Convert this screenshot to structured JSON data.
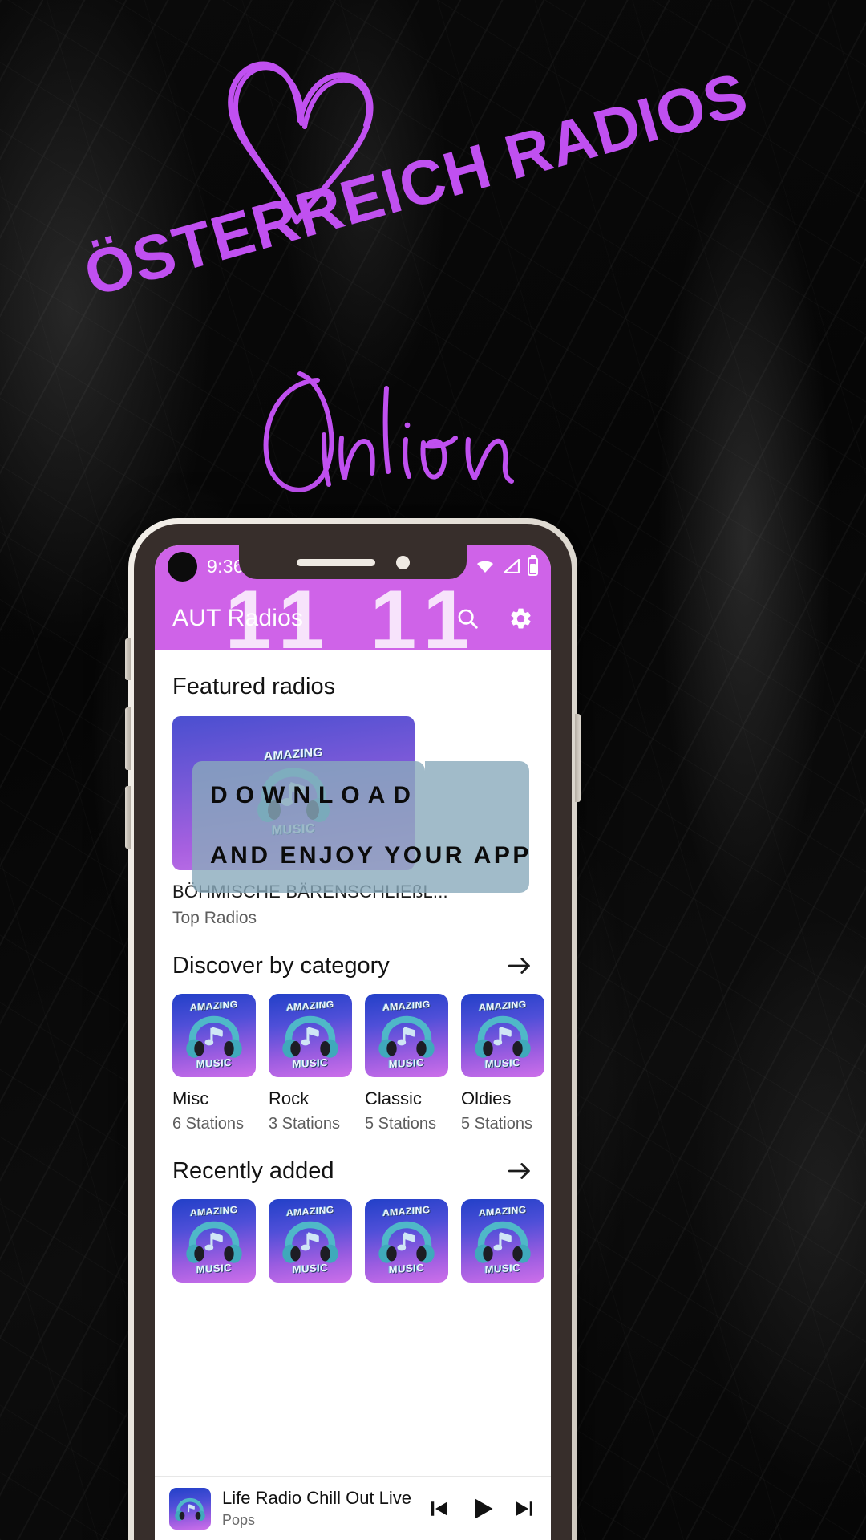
{
  "poster": {
    "heart_icon": "heart-doodle-icon",
    "title": "ÖSTERREICH RADIOS",
    "subtitle_script": "Online",
    "accent_color": "#c050f0",
    "overlay": {
      "line1": "DOWNLOAD",
      "line2": "AND ENJOY YOUR APP",
      "bg_color": "#89aabc"
    }
  },
  "phone": {
    "statusbar": {
      "time": "9:36",
      "icons": [
        "wifi-icon",
        "signal-icon",
        "battery-icon"
      ]
    },
    "watermark": "11 11",
    "appbar": {
      "title": "AUT Radios",
      "actions": [
        {
          "name": "search-icon",
          "label": "Search"
        },
        {
          "name": "gear-icon",
          "label": "Settings"
        }
      ],
      "bg_color": "#cf63e8"
    },
    "sections": {
      "featured": {
        "title": "Featured radios",
        "card": {
          "name": "BÖHMISCHE BÄRENSCHLIEßL...",
          "subtitle": "Top Radios",
          "logo_top": "AMAZING",
          "logo_bottom": "MUSIC"
        }
      },
      "categories": {
        "title": "Discover by category",
        "more_icon": "arrow-right-icon",
        "items": [
          {
            "name": "Misc",
            "count": "6 Stations"
          },
          {
            "name": "Rock",
            "count": "3 Stations"
          },
          {
            "name": "Classic",
            "count": "5 Stations"
          },
          {
            "name": "Oldies",
            "count": "5 Stations"
          }
        ]
      },
      "recently_added": {
        "title": "Recently added",
        "more_icon": "arrow-right-icon",
        "items": [
          {
            "logo_top": "AMAZING",
            "logo_bottom": "MUSIC"
          },
          {
            "logo_top": "AMAZING",
            "logo_bottom": "MUSIC"
          },
          {
            "logo_top": "AMAZING",
            "logo_bottom": "MUSIC"
          },
          {
            "logo_top": "AMAZING",
            "logo_bottom": "MUSIC"
          }
        ]
      }
    },
    "player": {
      "title": "Life Radio Chill Out Live",
      "subtitle": "Pops",
      "controls": [
        {
          "name": "previous-button",
          "glyph": "prev"
        },
        {
          "name": "play-button",
          "glyph": "play"
        },
        {
          "name": "next-button",
          "glyph": "next"
        }
      ]
    }
  }
}
